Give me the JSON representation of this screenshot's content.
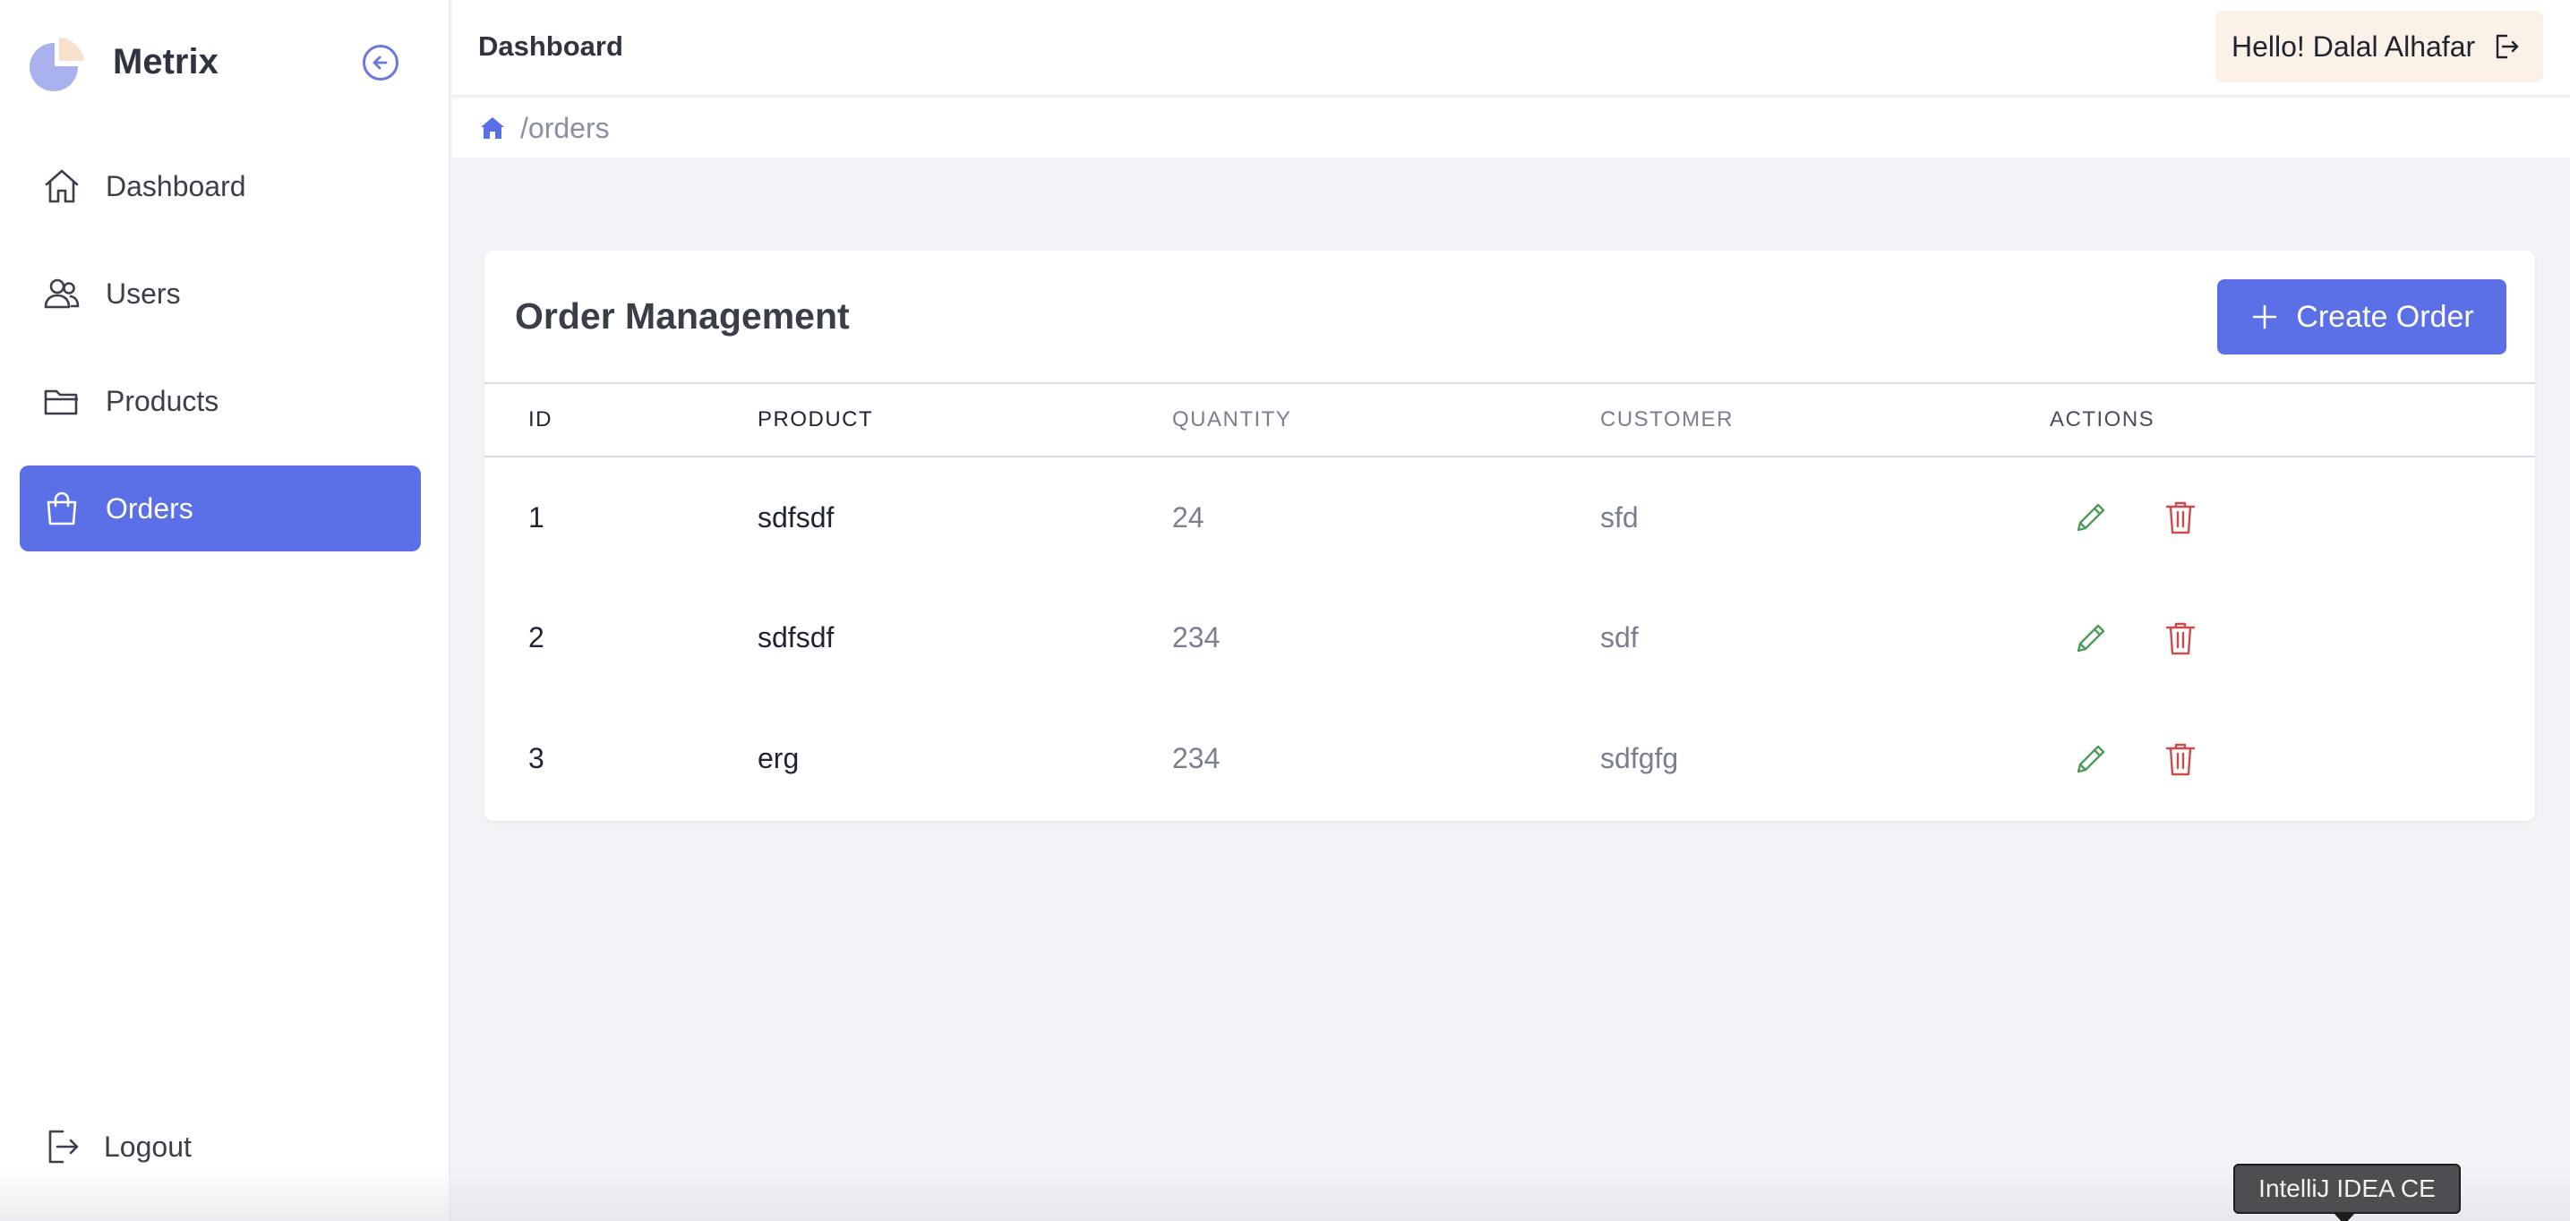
{
  "app": {
    "name": "Metrix"
  },
  "colors": {
    "accent": "#5b6fe6",
    "edit": "#4f9a5a",
    "delete": "#cf4b4b",
    "greeting_bg": "#fbf1e6"
  },
  "sidebar": {
    "collapse_icon": "arrow-left-circle-icon",
    "items": [
      {
        "label": "Dashboard",
        "icon": "home-icon"
      },
      {
        "label": "Users",
        "icon": "users-icon"
      },
      {
        "label": "Products",
        "icon": "folder-icon"
      },
      {
        "label": "Orders",
        "icon": "shopping-bag-icon",
        "active": true
      }
    ],
    "logout_label": "Logout"
  },
  "header": {
    "title": "Dashboard",
    "greeting": "Hello! Dalal Alhafar",
    "breadcrumb": "/orders"
  },
  "orders": {
    "title": "Order Management",
    "create_label": "Create Order",
    "columns": [
      "ID",
      "PRODUCT",
      "QUANTITY",
      "CUSTOMER",
      "ACTIONS"
    ],
    "rows": [
      {
        "id": "1",
        "product": "sdfsdf",
        "quantity": "24",
        "customer": "sfd"
      },
      {
        "id": "2",
        "product": "sdfsdf",
        "quantity": "234",
        "customer": "sdf"
      },
      {
        "id": "3",
        "product": "erg",
        "quantity": "234",
        "customer": "sdfgfg"
      }
    ]
  },
  "tooltip": "IntelliJ IDEA CE"
}
